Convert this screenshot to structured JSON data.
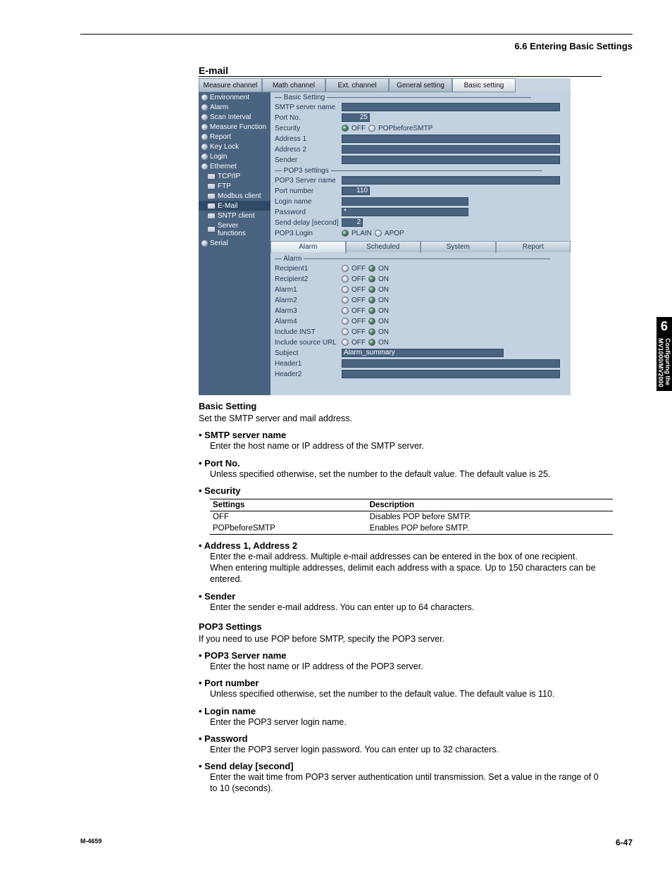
{
  "running_head": "6.6  Entering Basic Settings",
  "section_email": "E-mail",
  "ui": {
    "top_tabs": [
      "Measure channel",
      "Math channel",
      "Ext. channel",
      "General setting",
      "Basic setting"
    ],
    "sidebar": [
      {
        "t": "Environment",
        "sub": false,
        "i": "r"
      },
      {
        "t": "Alarm",
        "sub": false,
        "i": "r"
      },
      {
        "t": "Scan Interval",
        "sub": false,
        "i": "r"
      },
      {
        "t": "Measure Function",
        "sub": false,
        "i": "r"
      },
      {
        "t": "Report",
        "sub": false,
        "i": "r"
      },
      {
        "t": "Key Lock",
        "sub": false,
        "i": "r"
      },
      {
        "t": "Login",
        "sub": false,
        "i": "r"
      },
      {
        "t": "Ethernet",
        "sub": false,
        "i": "r"
      },
      {
        "t": "TCP/IP",
        "sub": true,
        "i": "b"
      },
      {
        "t": "FTP",
        "sub": true,
        "i": "b"
      },
      {
        "t": "Modbus client",
        "sub": true,
        "i": "b"
      },
      {
        "t": "E-Mail",
        "sub": true,
        "i": "b",
        "sel": true
      },
      {
        "t": "SNTP client",
        "sub": true,
        "i": "b"
      },
      {
        "t": "Server functions",
        "sub": true,
        "i": "b"
      },
      {
        "t": "Serial",
        "sub": false,
        "i": "r"
      }
    ],
    "basic": {
      "title": "Basic Setting",
      "smtp_label": "SMTP server name",
      "port_label": "Port No.",
      "port_value": "25",
      "security_label": "Security",
      "security_opts": [
        "OFF",
        "POPbeforeSMTP"
      ],
      "addr1_label": "Address 1",
      "addr2_label": "Address 2",
      "sender_label": "Sender"
    },
    "pop3": {
      "title": "POP3 settings",
      "server_label": "POP3 Server name",
      "port_label": "Port number",
      "port_value": "110",
      "login_label": "Login name",
      "pwd_label": "Password",
      "pwd_value": "*",
      "delay_label": "Send delay [second]",
      "delay_value": "2",
      "pop3login_label": "POP3 Login",
      "pop3login_opts": [
        "PLAIN",
        "APOP"
      ]
    },
    "sub_tabs": [
      "Alarm",
      "Scheduled",
      "System",
      "Report"
    ],
    "alarm": {
      "title": "Alarm",
      "rows": [
        {
          "label": "Recipient1"
        },
        {
          "label": "Recipient2"
        },
        {
          "label": "Alarm1"
        },
        {
          "label": "Alarm2"
        },
        {
          "label": "Alarm3"
        },
        {
          "label": "Alarm4"
        },
        {
          "label": "Include INST"
        },
        {
          "label": "Include source URL"
        }
      ],
      "off": "OFF",
      "on": "ON",
      "subject_label": "Subject",
      "subject_value": "Alarm_summary",
      "h1_label": "Header1",
      "h2_label": "Header2"
    }
  },
  "doc": {
    "basic_title": "Basic Setting",
    "basic_para": "Set the SMTP server and mail address.",
    "b1": "SMTP server name",
    "b1t": "Enter the host name or IP address of the SMTP server.",
    "b2": "Port No.",
    "b2t": "Unless specified otherwise, set the number to the default value.  The default value is 25.",
    "b3": "Security",
    "sec_tbl": {
      "h1": "Settings",
      "h2": "Description",
      "r1a": "OFF",
      "r1b": "Disables POP before SMTP.",
      "r2a": "POPbeforeSMTP",
      "r2b": "Enables POP before SMTP."
    },
    "b4": "Address 1, Address 2",
    "b4t": "Enter the e-mail address.  Multiple e-mail addresses can be entered in the box of one recipient.  When entering multiple addresses, delimit each address with a space.  Up to 150 characters can be entered.",
    "b5": "Sender",
    "b5t": "Enter the sender e-mail address.  You can enter up to 64 characters.",
    "pop3_title": "POP3 Settings",
    "pop3_para": "If you need to use POP before SMTP, specify the POP3 server.",
    "p1": "POP3 Server name",
    "p1t": "Enter the host name or IP address of the POP3 server.",
    "p2": "Port number",
    "p2t": "Unless specified otherwise, set the number to the default value. The default value is 110.",
    "p3": "Login name",
    "p3t": "Enter the POP3 server login name.",
    "p4": "Password",
    "p4t": "Enter the POP3 server login password. You can enter up to 32 characters.",
    "p5": "Send delay [second]",
    "p5t": "Enter the wait time from POP3 server authentication until transmission. Set a value in the range of 0 to 10 (seconds)."
  },
  "thumb": {
    "num": "6",
    "text": "Configuring the MV1000/MV2000"
  },
  "footer": {
    "left": "M-4659",
    "right": "6-47"
  }
}
